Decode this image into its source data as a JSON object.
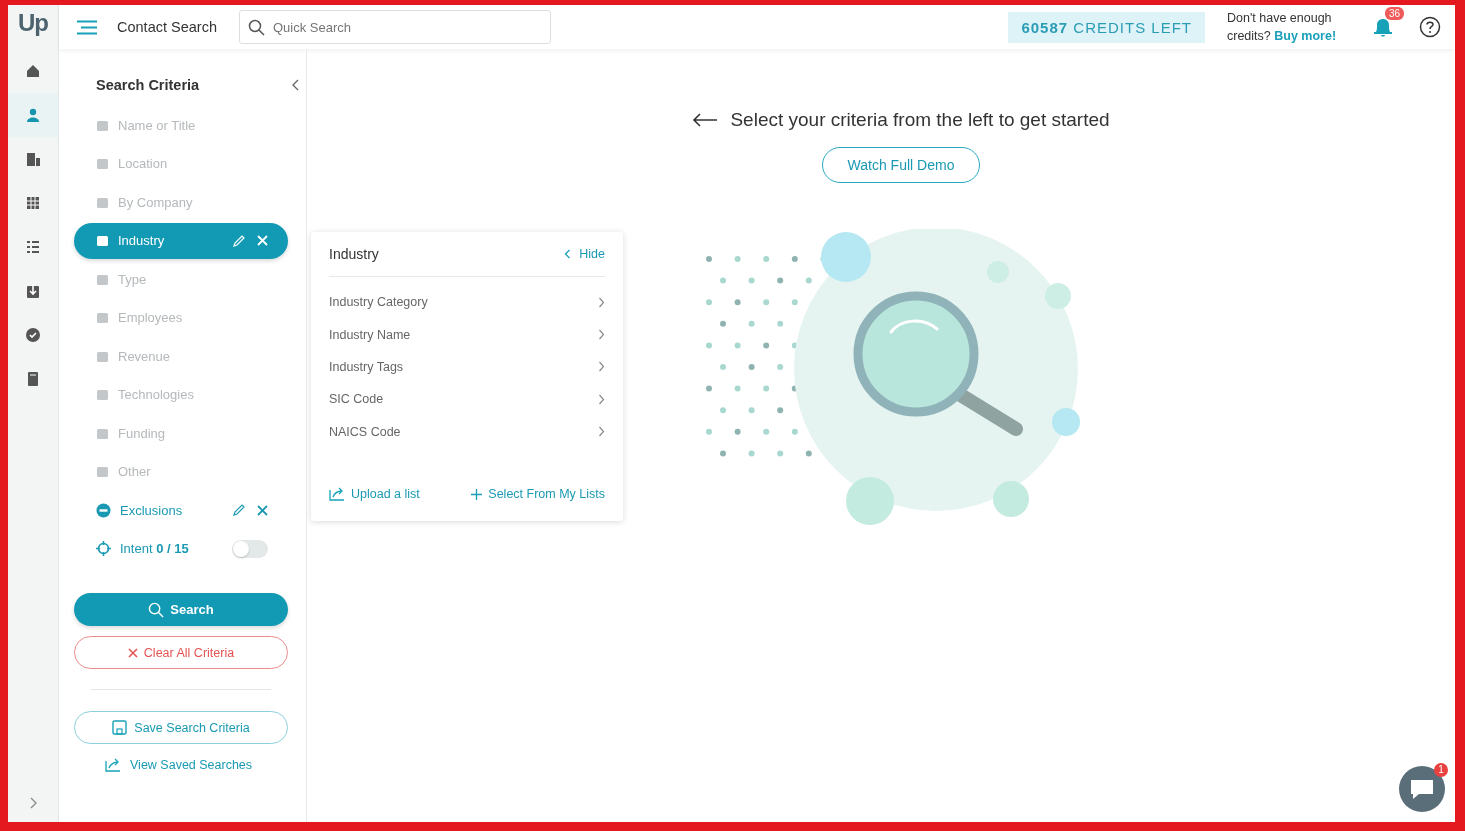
{
  "logo": "Up",
  "rail": {
    "items": [
      {
        "selected": false
      },
      {
        "selected": true
      },
      {
        "selected": false
      },
      {
        "selected": false
      },
      {
        "selected": false
      },
      {
        "selected": false
      },
      {
        "selected": false
      },
      {
        "selected": false
      }
    ]
  },
  "top_bar": {
    "title": "Contact Search",
    "search": {
      "placeholder": "Quick Search"
    },
    "credits": {
      "count": "60587",
      "label": "CREDITS LEFT"
    },
    "buy_prompt": {
      "text": "Don't have enough credits?",
      "link": "Buy more!"
    },
    "notifications": {
      "count": "36"
    }
  },
  "criteria": {
    "title": "Search Criteria",
    "items": [
      {
        "kind": "filter",
        "label": "Name or Title",
        "selected": false,
        "applied": false
      },
      {
        "kind": "filter",
        "label": "Location",
        "selected": false,
        "applied": false
      },
      {
        "kind": "filter",
        "label": "By Company",
        "selected": false,
        "applied": false
      },
      {
        "kind": "filter",
        "label": "Industry",
        "selected": true,
        "applied": true
      },
      {
        "kind": "filter",
        "label": "Type",
        "selected": false,
        "applied": false
      },
      {
        "kind": "filter",
        "label": "Employees",
        "selected": false,
        "applied": false
      },
      {
        "kind": "filter",
        "label": "Revenue",
        "selected": false,
        "applied": false
      },
      {
        "kind": "filter",
        "label": "Technologies",
        "selected": false,
        "applied": false
      },
      {
        "kind": "filter",
        "label": "Funding",
        "selected": false,
        "applied": false
      },
      {
        "kind": "filter",
        "label": "Other",
        "selected": false,
        "applied": false
      },
      {
        "kind": "exclusions",
        "label": "Exclusions",
        "selected": false,
        "applied": true
      },
      {
        "kind": "intent",
        "label": "Intent",
        "count": "0 / 15",
        "on": false
      }
    ],
    "search_button": "Search",
    "clear_button": "Clear All Criteria",
    "save_button": "Save Search Criteria",
    "saved_link": "View Saved Searches"
  },
  "industry_panel": {
    "title": "Industry",
    "hide": "Hide",
    "options": [
      "Industry Category",
      "Industry Name",
      "Industry Tags",
      "SIC Code",
      "NAICS Code"
    ],
    "upload": "Upload a list",
    "select_lists": "Select From My Lists"
  },
  "main": {
    "heading": "Select your criteria from the left to get started",
    "demo_button": "Watch Full Demo"
  },
  "chat": {
    "badge": "1"
  }
}
